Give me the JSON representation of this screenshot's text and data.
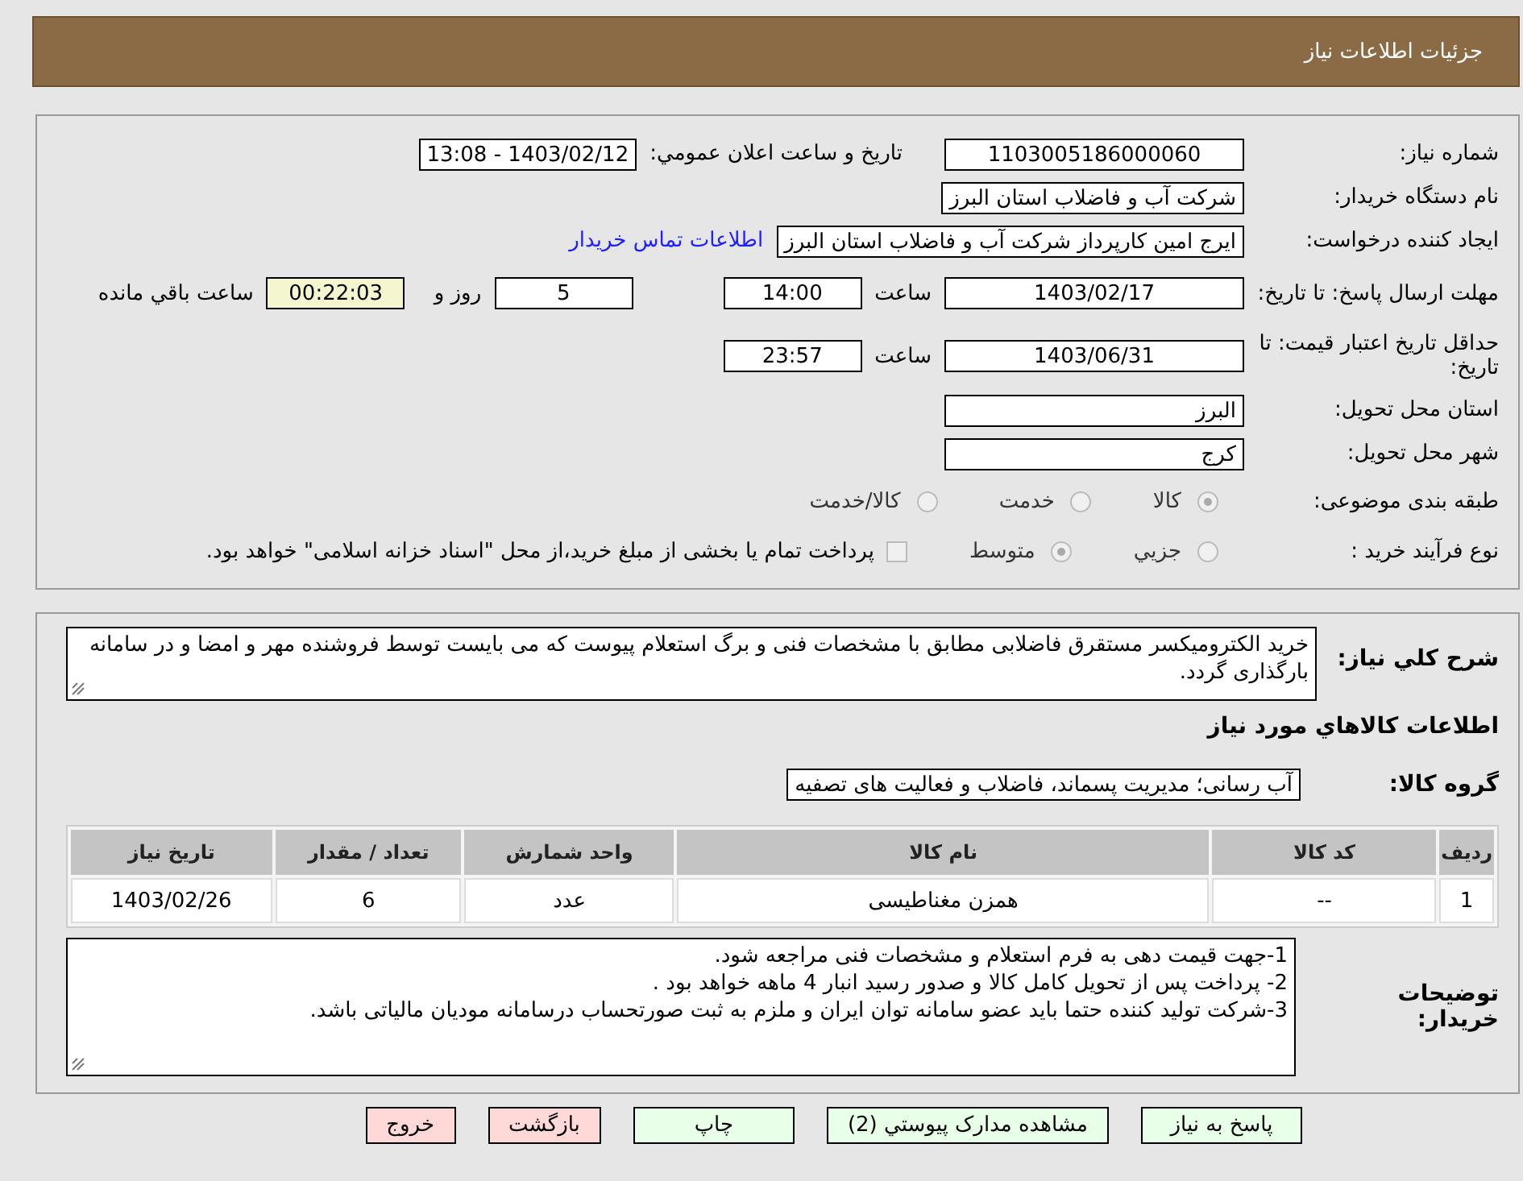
{
  "header": {
    "title": "جزئیات اطلاعات نیاز"
  },
  "need_number": {
    "label": "شماره نیاز:",
    "value": "1103005186000060"
  },
  "announce": {
    "label": "تاریخ و ساعت اعلان عمومي:",
    "value": "1403/02/12 - 13:08"
  },
  "buyer": {
    "label": "نام دستگاه خریدار:",
    "value": "شرکت آب و فاضلاب استان البرز"
  },
  "creator": {
    "label": "ایجاد کننده درخواست:",
    "value": "ایرج امین کارپرداز شرکت آب و فاضلاب استان البرز",
    "link": "اطلاعات تماس خریدار"
  },
  "deadline": {
    "label": "مهلت ارسال پاسخ: تا تاریخ:",
    "date": "1403/02/17",
    "time_label": "ساعت",
    "time": "14:00",
    "days": "5",
    "days_label": "روز و",
    "remaining": "00:22:03",
    "remaining_label": "ساعت باقي مانده"
  },
  "validity": {
    "label": "حداقل تاریخ اعتبار قیمت: تا تاریخ:",
    "date": "1403/06/31",
    "time_label": "ساعت",
    "time": "23:57"
  },
  "province": {
    "label": "استان محل تحویل:",
    "value": "البرز"
  },
  "city": {
    "label": "شهر محل تحویل:",
    "value": "کرج"
  },
  "category": {
    "label": "طبقه بندی موضوعی:",
    "options": [
      {
        "label": "کالا",
        "selected": true
      },
      {
        "label": "خدمت",
        "selected": false
      },
      {
        "label": "کالا/خدمت",
        "selected": false
      }
    ]
  },
  "process": {
    "label": "نوع فرآیند خرید :",
    "options": [
      {
        "label": "جزيي",
        "selected": false
      },
      {
        "label": "متوسط",
        "selected": true
      }
    ],
    "treasury": {
      "label": "پرداخت تمام یا بخشی از مبلغ خرید،از محل \"اسناد خزانه اسلامی\" خواهد بود.",
      "checked": false
    }
  },
  "description": {
    "label": "شرح کلي نیاز:",
    "text": "خرید الکترومیکسر مستقرق فاضلابی مطابق با مشخصات فنی و برگ استعلام پیوست که می بایست توسط فروشنده مهر و امضا و در سامانه بارگذاری گردد."
  },
  "goods_title": "اطلاعات کالاهاي مورد نیاز",
  "goods_group": {
    "label": "گروه کالا:",
    "value": "آب رسانی؛ مدیریت پسماند، فاضلاب و فعالیت های تصفیه"
  },
  "table": {
    "columns": [
      "ردیف",
      "کد کالا",
      "نام کالا",
      "واحد شمارش",
      "تعداد / مقدار",
      "تاریخ نیاز"
    ],
    "rows": [
      [
        "1",
        "--",
        "همزن مغناطیسی",
        "عدد",
        "6",
        "1403/02/26"
      ]
    ]
  },
  "buyer_notes": {
    "label": "توضیحات خریدار:",
    "lines": [
      "1-جهت قیمت دهی به فرم استعلام و مشخصات فنی مراجعه شود.",
      "2- پرداخت پس از تحویل کامل کالا و صدور رسید انبار 4 ماهه خواهد بود .",
      "3-شرکت تولید کننده حتما باید عضو سامانه توان ایران و ملزم به ثبت صورتحساب درسامانه مودیان مالیاتی باشد."
    ]
  },
  "buttons": [
    {
      "label": "پاسخ به نیاز",
      "kind": "primary"
    },
    {
      "label": "مشاهده مدارک پیوستي (2)",
      "kind": "primary"
    },
    {
      "label": "چاپ",
      "kind": "primary"
    },
    {
      "label": "بازگشت",
      "kind": "danger"
    },
    {
      "label": "خروج",
      "kind": "danger"
    }
  ]
}
